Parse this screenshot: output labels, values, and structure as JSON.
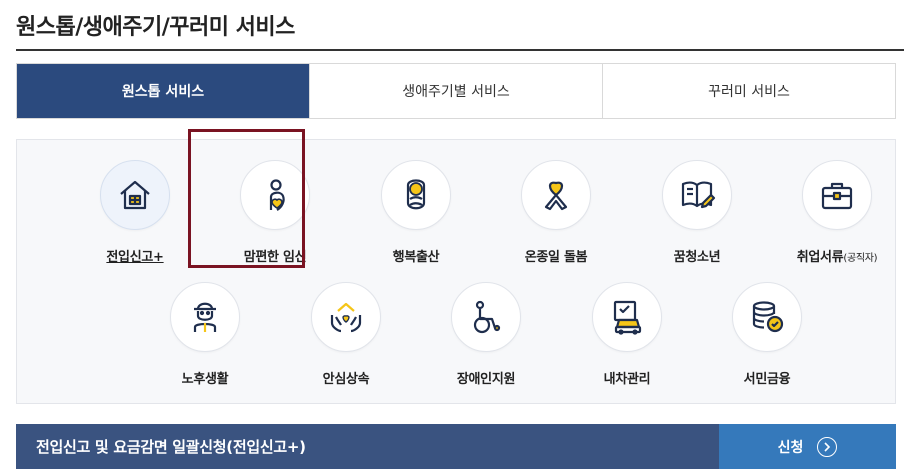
{
  "page": {
    "title": "원스톱/생애주기/꾸러미 서비스"
  },
  "tabs": [
    {
      "label": "원스톱 서비스",
      "active": true
    },
    {
      "label": "생애주기별 서비스",
      "active": false
    },
    {
      "label": "꾸러미 서비스",
      "active": false
    }
  ],
  "services": [
    {
      "label": "전입신고+",
      "icon": "house-icon"
    },
    {
      "label": "맘편한 임신",
      "icon": "pregnancy-icon"
    },
    {
      "label": "행복출산",
      "icon": "baby-icon"
    },
    {
      "label": "온종일 돌봄",
      "icon": "care-ribbon-icon"
    },
    {
      "label": "꿈청소년",
      "icon": "book-pencil-icon"
    },
    {
      "label": "취업서류",
      "label_sub": "(공직자)",
      "icon": "briefcase-icon"
    },
    {
      "label": "노후생활",
      "icon": "elder-icon"
    },
    {
      "label": "안심상속",
      "icon": "hands-house-icon"
    },
    {
      "label": "장애인지원",
      "icon": "wheelchair-icon"
    },
    {
      "label": "내차관리",
      "icon": "car-document-icon"
    },
    {
      "label": "서민금융",
      "icon": "coins-icon"
    }
  ],
  "bottom": {
    "text": "전입신고 및 요금감면 일괄신청(전입신고+)",
    "button_label": "신청"
  },
  "colors": {
    "navy": "#2b4a7e",
    "accent_yellow": "#f5c518",
    "highlight": "#7a1322",
    "button_blue": "#3579bb"
  }
}
